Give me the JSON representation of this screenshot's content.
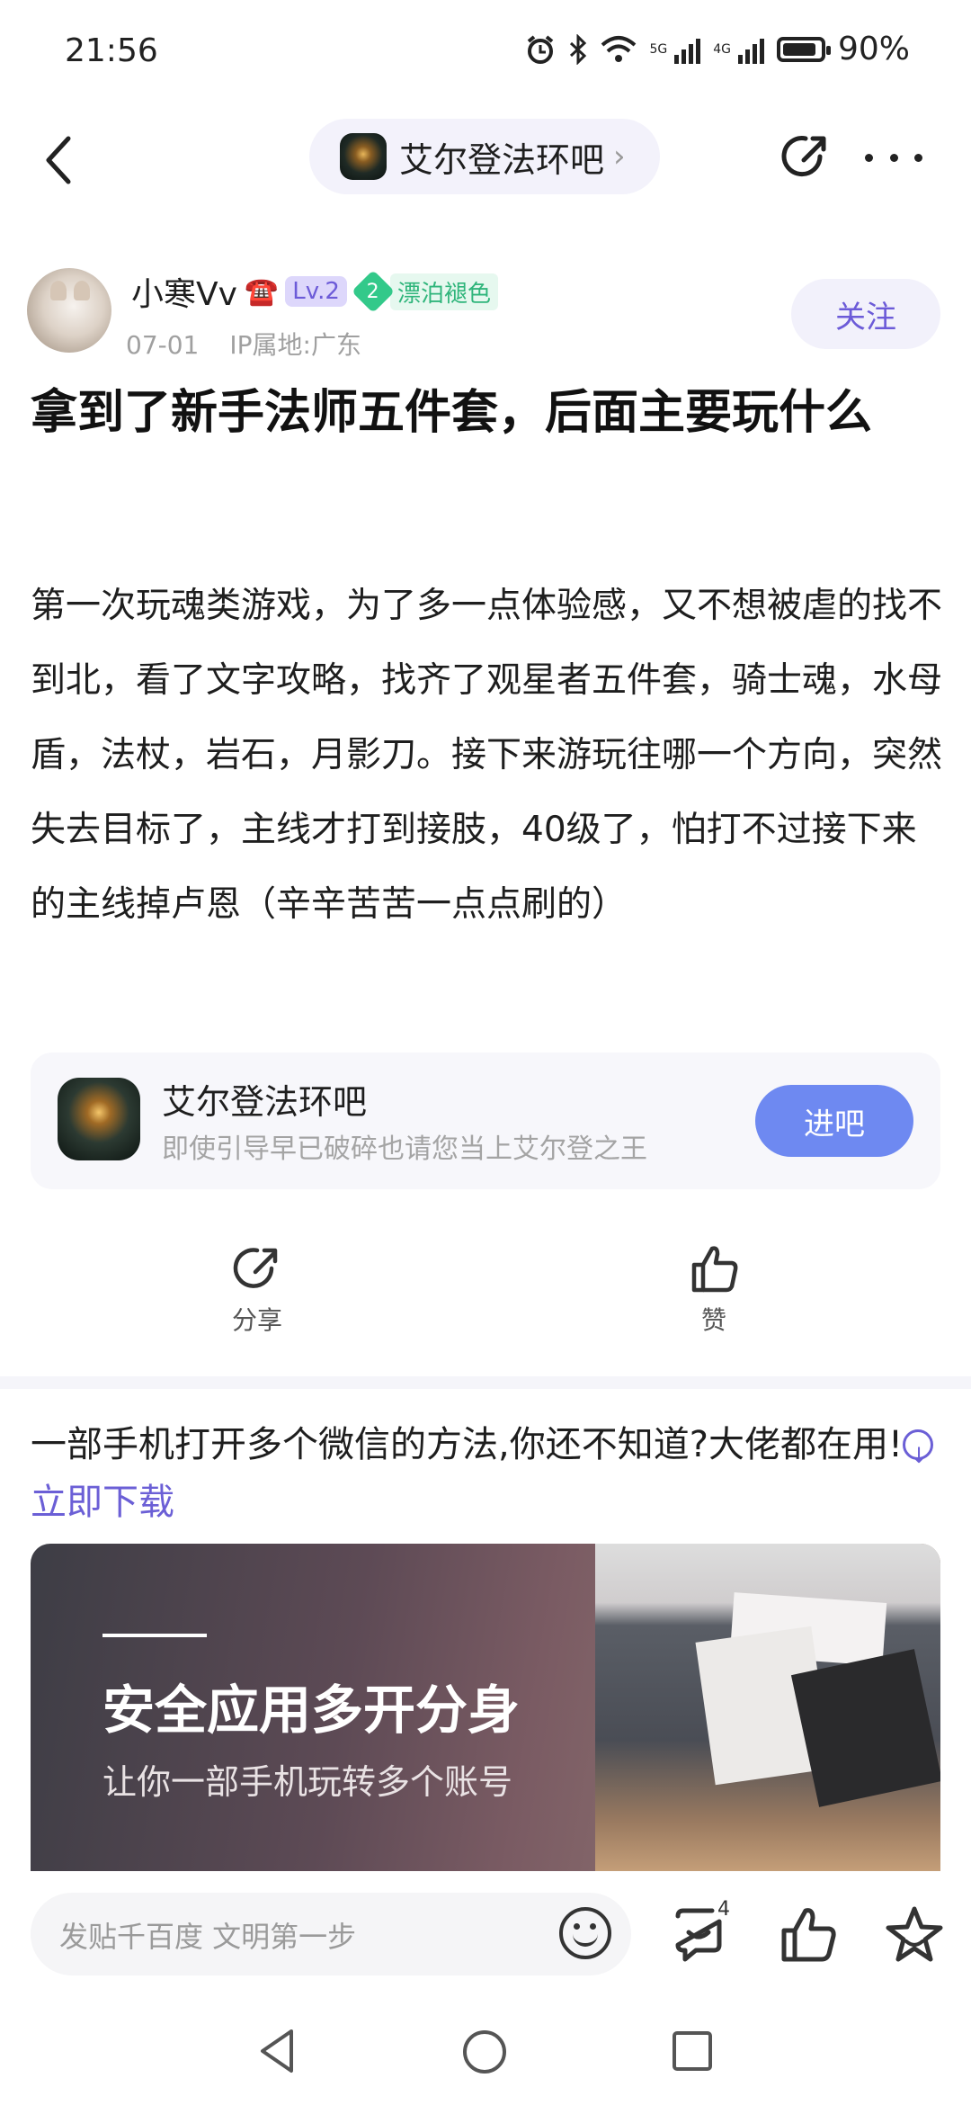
{
  "status_bar": {
    "time": "21:56",
    "network_5g": "5G",
    "network_4g": "4G",
    "battery": "90%",
    "battery_level": 0.9
  },
  "header": {
    "forum_name": "艾尔登法环吧",
    "chevron": "›"
  },
  "post": {
    "author": {
      "name": "小寒Vv",
      "name_suffix_icon": "☎️",
      "level": "Lv.2",
      "badge_number": "2",
      "badge_title": "漂泊褪色",
      "date": "07-01",
      "ip": "IP属地:广东"
    },
    "follow_label": "关注",
    "title": "拿到了新手法师五件套，后面主要玩什么",
    "body": "第一次玩魂类游戏，为了多一点体验感，又不想被虐的找不到北，看了文字攻略，找齐了观星者五件套，骑士魂，水母盾，法杖，岩石，月影刀。接下来游玩往哪一个方向，突然失去目标了，主线才打到接肢，40级了，怕打不过接下来的主线掉卢恩（辛辛苦苦一点点刷的）"
  },
  "forum_card": {
    "name": "艾尔登法环吧",
    "description": "即使引导早已破碎也请您当上艾尔登之王",
    "enter_label": "进吧"
  },
  "actions": {
    "share_label": "分享",
    "like_label": "赞"
  },
  "ad": {
    "text": "一部手机打开多个微信的方法,你还不知道?大佬都在用!",
    "link_label": "立即下载",
    "image_headline": "安全应用多开分身",
    "image_subline": "让你一部手机玩转多个账号"
  },
  "bottom_bar": {
    "input_placeholder": "发贴千百度 文明第一步",
    "comment_count": "4"
  },
  "icons": {
    "back": "back-arrow-icon",
    "share": "share-icon",
    "more": "more-icon",
    "emoji": "emoji-icon",
    "comment": "comment-icon",
    "like": "thumbs-up-icon",
    "favorite": "star-icon"
  },
  "colors": {
    "accent_purple": "#6c5bd8",
    "enter_button_blue": "#6e89f1",
    "badge_green": "#33c98a"
  }
}
